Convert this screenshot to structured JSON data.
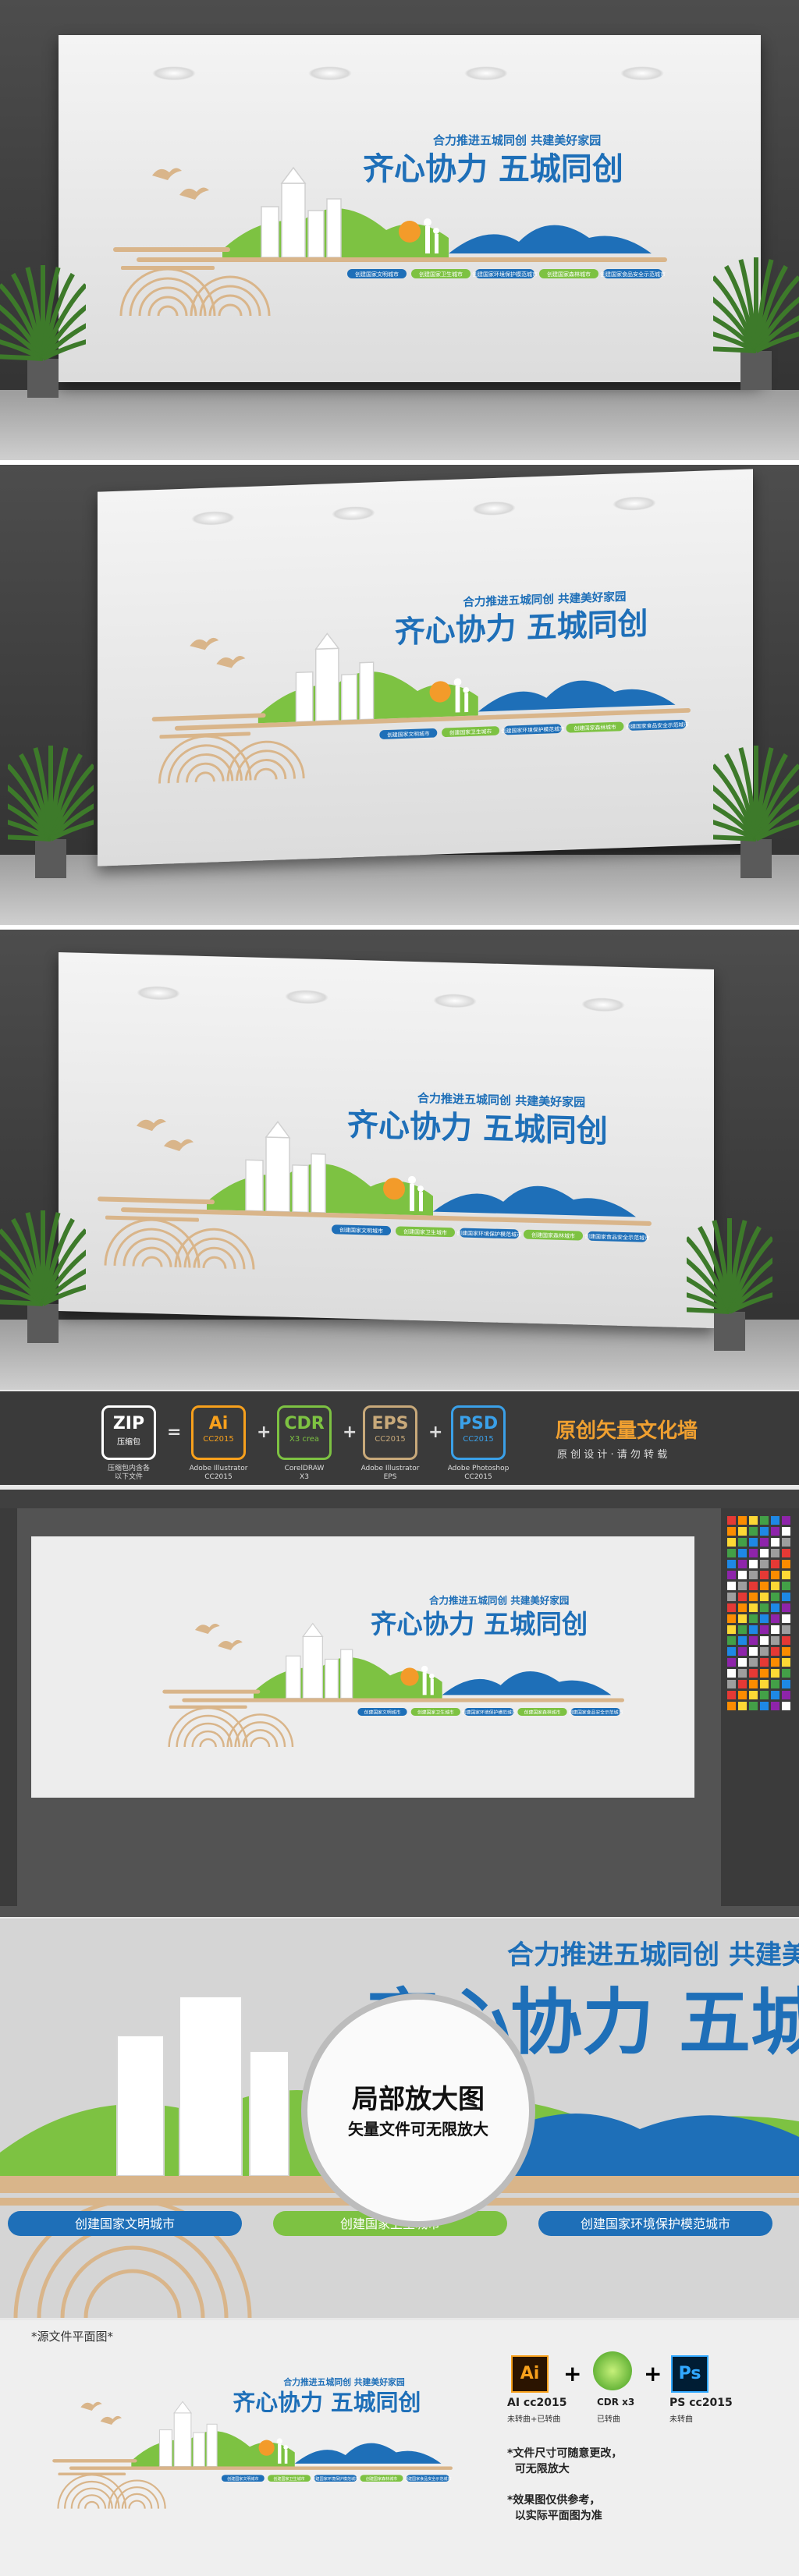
{
  "sign": {
    "subtitle": "合力推进五城同创  共建美好家园",
    "title": "齐心协力  五城同创",
    "tags": [
      "创建国家文明城市",
      "创建国家卫生城市",
      "创建国家环境保护模范城市",
      "创建国家森林城市",
      "创建国家食品安全示范城市"
    ]
  },
  "formats": [
    {
      "big": "ZIP",
      "small": "压缩包",
      "note": "压缩包内含各\n以下文件",
      "color": "#ffffff"
    },
    {
      "big": "Ai",
      "small": "CC2015",
      "note": "Adobe Illustrator\nCC2015",
      "color": "#f7a01c"
    },
    {
      "big": "CDR",
      "small": "X3 crea",
      "note": "CorelDRAW\nX3",
      "color": "#7dc242"
    },
    {
      "big": "EPS",
      "small": "CC2015",
      "note": "Adobe Illustrator\nEPS",
      "color": "#c8a97a"
    },
    {
      "big": "PSD",
      "small": "CC2015",
      "note": "Adobe Photoshop\nCC2015",
      "color": "#3aa0e8"
    }
  ],
  "brand": {
    "title": "原创矢量文化墙",
    "subtitle": "原 创 设 计 · 请 勿 转 载"
  },
  "zoom": {
    "title": "局部放大图",
    "subtitle": "矢量文件可无限放大",
    "big_text": "齐心协力  五城",
    "top_text": "合力推进五城同创  共建美好",
    "tags": [
      "创建国家文明城市",
      "创建国家卫生城市",
      "创建国家环境保护模范城市"
    ]
  },
  "plan": {
    "label": "*源文件平面图*",
    "ai_label": "AI cc2015",
    "ai_note": "未转曲+已转曲",
    "cdr_label": "CDR x3",
    "cdr_note": "已转曲",
    "ps_label": "PS cc2015",
    "ps_note": "未转曲",
    "note1": "*文件尺寸可随意更改，\n  可无限放大",
    "note2": "*效果图仅供参考，\n  以实际平面图为准"
  },
  "colors": {
    "blue": "#1e6fb8",
    "green": "#7dc242",
    "tan": "#d9b58a",
    "orange": "#f39b2a"
  }
}
